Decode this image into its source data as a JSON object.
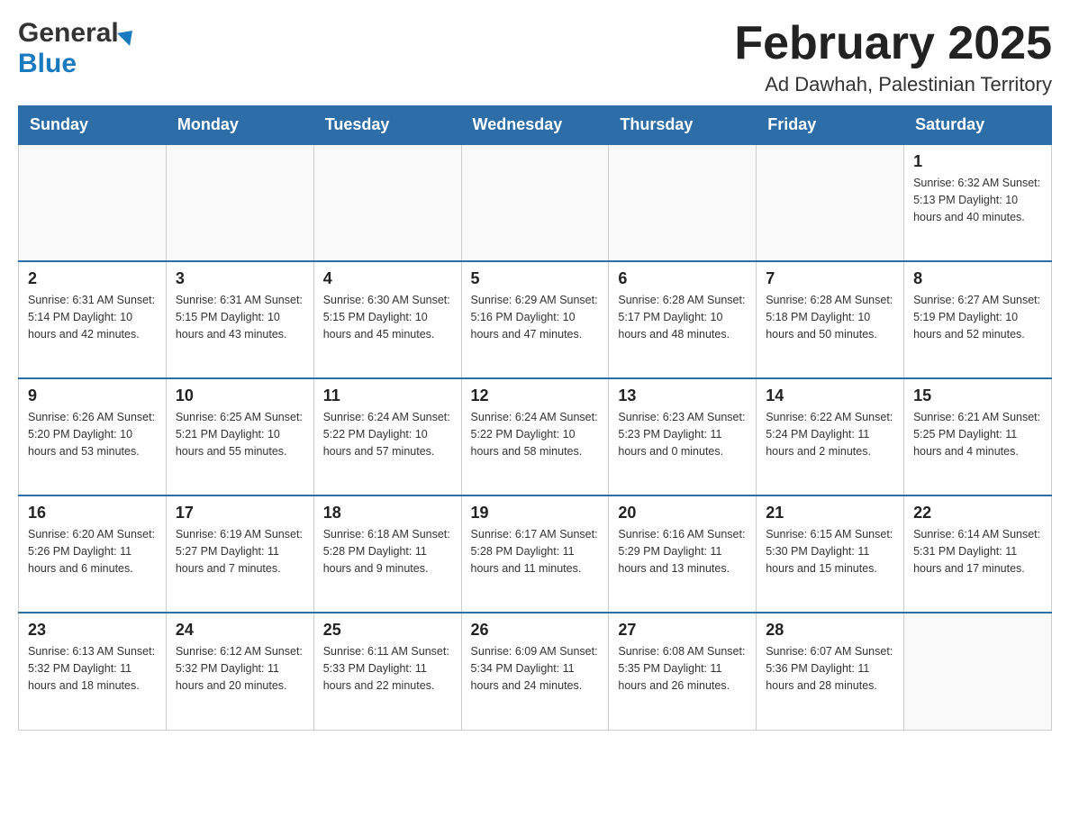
{
  "header": {
    "logo_general": "General",
    "logo_blue": "Blue",
    "title": "February 2025",
    "location": "Ad Dawhah, Palestinian Territory"
  },
  "days_of_week": [
    "Sunday",
    "Monday",
    "Tuesday",
    "Wednesday",
    "Thursday",
    "Friday",
    "Saturday"
  ],
  "weeks": [
    {
      "days": [
        {
          "number": "",
          "info": ""
        },
        {
          "number": "",
          "info": ""
        },
        {
          "number": "",
          "info": ""
        },
        {
          "number": "",
          "info": ""
        },
        {
          "number": "",
          "info": ""
        },
        {
          "number": "",
          "info": ""
        },
        {
          "number": "1",
          "info": "Sunrise: 6:32 AM\nSunset: 5:13 PM\nDaylight: 10 hours\nand 40 minutes."
        }
      ]
    },
    {
      "days": [
        {
          "number": "2",
          "info": "Sunrise: 6:31 AM\nSunset: 5:14 PM\nDaylight: 10 hours\nand 42 minutes."
        },
        {
          "number": "3",
          "info": "Sunrise: 6:31 AM\nSunset: 5:15 PM\nDaylight: 10 hours\nand 43 minutes."
        },
        {
          "number": "4",
          "info": "Sunrise: 6:30 AM\nSunset: 5:15 PM\nDaylight: 10 hours\nand 45 minutes."
        },
        {
          "number": "5",
          "info": "Sunrise: 6:29 AM\nSunset: 5:16 PM\nDaylight: 10 hours\nand 47 minutes."
        },
        {
          "number": "6",
          "info": "Sunrise: 6:28 AM\nSunset: 5:17 PM\nDaylight: 10 hours\nand 48 minutes."
        },
        {
          "number": "7",
          "info": "Sunrise: 6:28 AM\nSunset: 5:18 PM\nDaylight: 10 hours\nand 50 minutes."
        },
        {
          "number": "8",
          "info": "Sunrise: 6:27 AM\nSunset: 5:19 PM\nDaylight: 10 hours\nand 52 minutes."
        }
      ]
    },
    {
      "days": [
        {
          "number": "9",
          "info": "Sunrise: 6:26 AM\nSunset: 5:20 PM\nDaylight: 10 hours\nand 53 minutes."
        },
        {
          "number": "10",
          "info": "Sunrise: 6:25 AM\nSunset: 5:21 PM\nDaylight: 10 hours\nand 55 minutes."
        },
        {
          "number": "11",
          "info": "Sunrise: 6:24 AM\nSunset: 5:22 PM\nDaylight: 10 hours\nand 57 minutes."
        },
        {
          "number": "12",
          "info": "Sunrise: 6:24 AM\nSunset: 5:22 PM\nDaylight: 10 hours\nand 58 minutes."
        },
        {
          "number": "13",
          "info": "Sunrise: 6:23 AM\nSunset: 5:23 PM\nDaylight: 11 hours\nand 0 minutes."
        },
        {
          "number": "14",
          "info": "Sunrise: 6:22 AM\nSunset: 5:24 PM\nDaylight: 11 hours\nand 2 minutes."
        },
        {
          "number": "15",
          "info": "Sunrise: 6:21 AM\nSunset: 5:25 PM\nDaylight: 11 hours\nand 4 minutes."
        }
      ]
    },
    {
      "days": [
        {
          "number": "16",
          "info": "Sunrise: 6:20 AM\nSunset: 5:26 PM\nDaylight: 11 hours\nand 6 minutes."
        },
        {
          "number": "17",
          "info": "Sunrise: 6:19 AM\nSunset: 5:27 PM\nDaylight: 11 hours\nand 7 minutes."
        },
        {
          "number": "18",
          "info": "Sunrise: 6:18 AM\nSunset: 5:28 PM\nDaylight: 11 hours\nand 9 minutes."
        },
        {
          "number": "19",
          "info": "Sunrise: 6:17 AM\nSunset: 5:28 PM\nDaylight: 11 hours\nand 11 minutes."
        },
        {
          "number": "20",
          "info": "Sunrise: 6:16 AM\nSunset: 5:29 PM\nDaylight: 11 hours\nand 13 minutes."
        },
        {
          "number": "21",
          "info": "Sunrise: 6:15 AM\nSunset: 5:30 PM\nDaylight: 11 hours\nand 15 minutes."
        },
        {
          "number": "22",
          "info": "Sunrise: 6:14 AM\nSunset: 5:31 PM\nDaylight: 11 hours\nand 17 minutes."
        }
      ]
    },
    {
      "days": [
        {
          "number": "23",
          "info": "Sunrise: 6:13 AM\nSunset: 5:32 PM\nDaylight: 11 hours\nand 18 minutes."
        },
        {
          "number": "24",
          "info": "Sunrise: 6:12 AM\nSunset: 5:32 PM\nDaylight: 11 hours\nand 20 minutes."
        },
        {
          "number": "25",
          "info": "Sunrise: 6:11 AM\nSunset: 5:33 PM\nDaylight: 11 hours\nand 22 minutes."
        },
        {
          "number": "26",
          "info": "Sunrise: 6:09 AM\nSunset: 5:34 PM\nDaylight: 11 hours\nand 24 minutes."
        },
        {
          "number": "27",
          "info": "Sunrise: 6:08 AM\nSunset: 5:35 PM\nDaylight: 11 hours\nand 26 minutes."
        },
        {
          "number": "28",
          "info": "Sunrise: 6:07 AM\nSunset: 5:36 PM\nDaylight: 11 hours\nand 28 minutes."
        },
        {
          "number": "",
          "info": ""
        }
      ]
    }
  ]
}
